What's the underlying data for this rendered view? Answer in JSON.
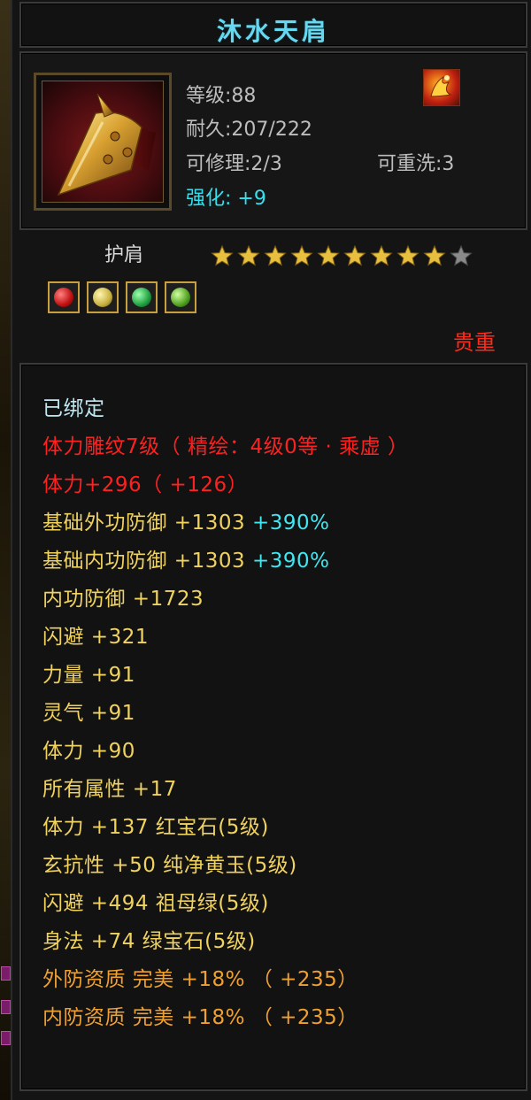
{
  "item": {
    "name": "沐水天肩",
    "type": "护肩",
    "rarity": "贵重",
    "level_label": "等级:",
    "level": "88",
    "durability_label": "耐久:",
    "durability": "207/222",
    "repair_label": "可修理:",
    "repair": "2/3",
    "rewash_label": "可重洗:",
    "rewash": "3",
    "enhance_label": "强化:",
    "enhance": "+9",
    "stars_filled": 9,
    "stars_total": 10,
    "gems": [
      "red-gem",
      "yellow-gem",
      "emerald-gem",
      "green-gem"
    ],
    "item_icon": "shoulder-armor-icon",
    "badge_icon": "phoenix-badge-icon"
  },
  "attributes": {
    "bound": "已绑定",
    "engrave": "体力雕纹7级（ 精绘：4级0等 · 乘虚 ）",
    "stamina_main": "体力+296（ +126）",
    "base_ext_def_label": "基础外功防御 +1303 ",
    "base_ext_def_pct": "+390%",
    "base_int_def_label": "基础内功防御 +1303 ",
    "base_int_def_pct": "+390%",
    "lines": [
      "内功防御 +1723",
      "闪避 +321",
      "力量 +91",
      "灵气 +91",
      "体力 +90",
      "所有属性 +17",
      "体力 +137 红宝石(5级)",
      "玄抗性 +50 纯净黄玉(5级)",
      "闪避 +494 祖母绿(5级)",
      "身法 +74 绿宝石(5级)"
    ],
    "quality_ext": "外防资质   完美 +18% （ +235）",
    "quality_int": "内防资质   完美 +18% （ +235）"
  },
  "colors": {
    "title": "#66d8f0",
    "bound": "#bfe8f0",
    "red_attr": "#ff2020",
    "yellow_attr": "#f0d260",
    "orange_attr": "#f0a030",
    "cyan_pct": "#40e6f0",
    "rarity": "#ff2a1a",
    "star_gold": "#e8c040"
  }
}
